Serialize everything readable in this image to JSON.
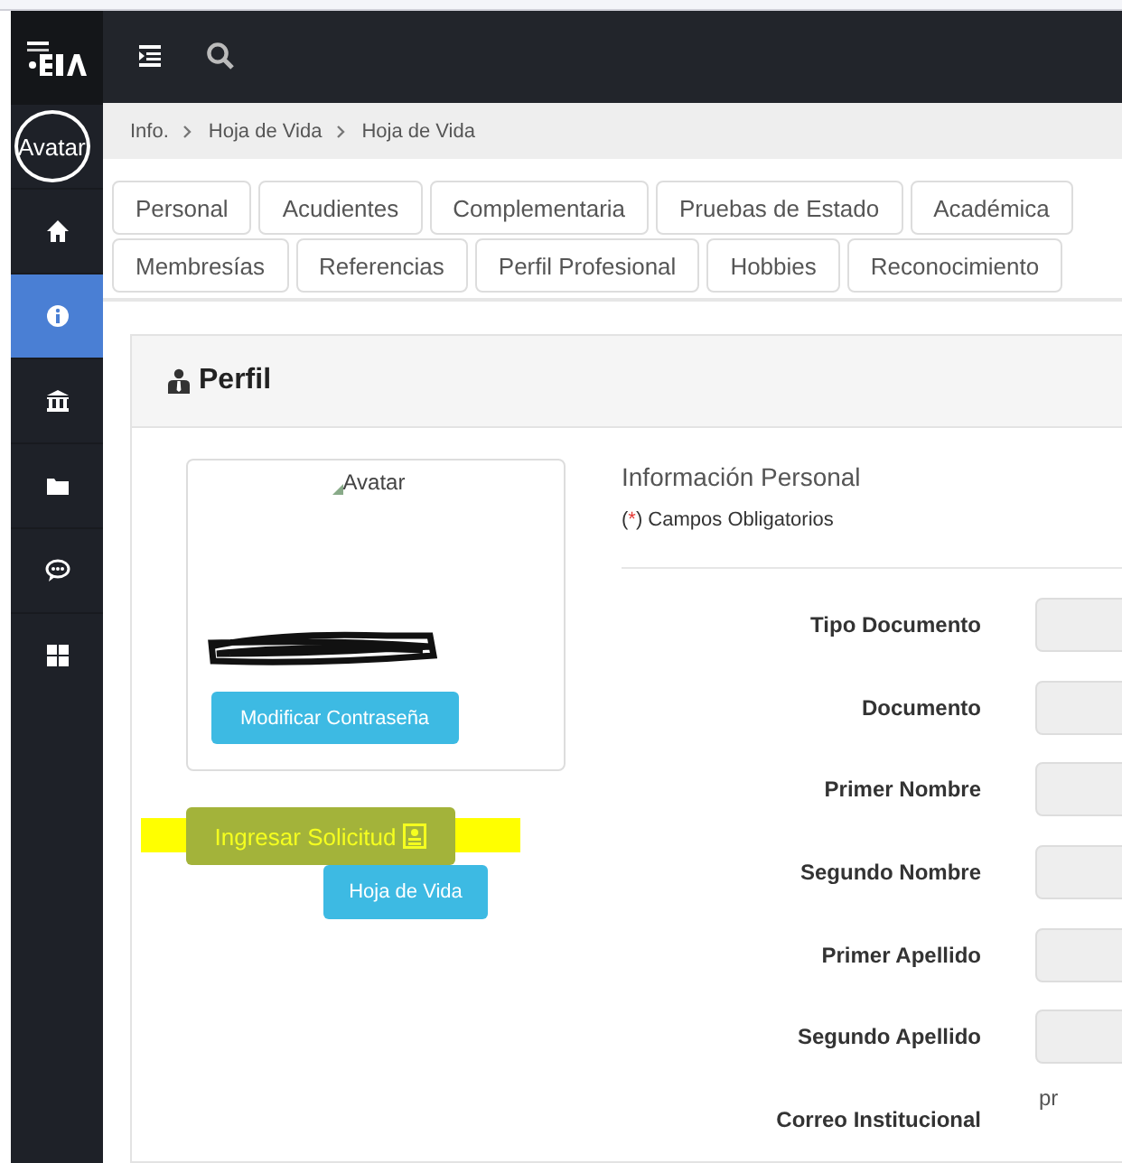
{
  "sidebar": {
    "avatar_alt": "Avatar",
    "items": [
      {
        "kind": "home",
        "selected": false
      },
      {
        "kind": "info",
        "selected": true
      },
      {
        "kind": "bank",
        "selected": false
      },
      {
        "kind": "folder",
        "selected": false
      },
      {
        "kind": "chat",
        "selected": false
      },
      {
        "kind": "grid",
        "selected": false
      }
    ]
  },
  "breadcrumb": [
    "Info.",
    "Hoja de Vida",
    "Hoja de Vida"
  ],
  "tab_rows": [
    {
      "tabs": [
        "Personal",
        "Acudientes",
        "Complementaria",
        "Pruebas de Estado",
        "Académica"
      ]
    },
    {
      "tabs": [
        "Membresías",
        "Referencias",
        "Perfil Profesional",
        "Hobbies",
        "Reconocimiento"
      ]
    }
  ],
  "panel": {
    "title": "Perfil",
    "profile_card": {
      "image_alt": "Avatar",
      "name_redacted": true,
      "button": "Modificar Contraseña"
    },
    "request_button": {
      "label": "Ingresar Solicitud",
      "highlighted": true
    },
    "cv_button": "Hoja de Vida",
    "section_title": "Información Personal",
    "note": {
      "open": "(",
      "mark": "*",
      "rest": ") Campos Obligatorios"
    },
    "fields": [
      {
        "kind": "input",
        "label": "Tipo Documento"
      },
      {
        "kind": "input",
        "label": "Documento"
      },
      {
        "kind": "input",
        "label": "Primer Nombre"
      },
      {
        "kind": "input",
        "label": "Segundo Nombre"
      },
      {
        "kind": "input",
        "label": "Primer Apellido"
      },
      {
        "kind": "input",
        "label": "Segundo Apellido"
      },
      {
        "kind": "text",
        "label": "Correo Institucional",
        "value": "pr"
      }
    ]
  }
}
